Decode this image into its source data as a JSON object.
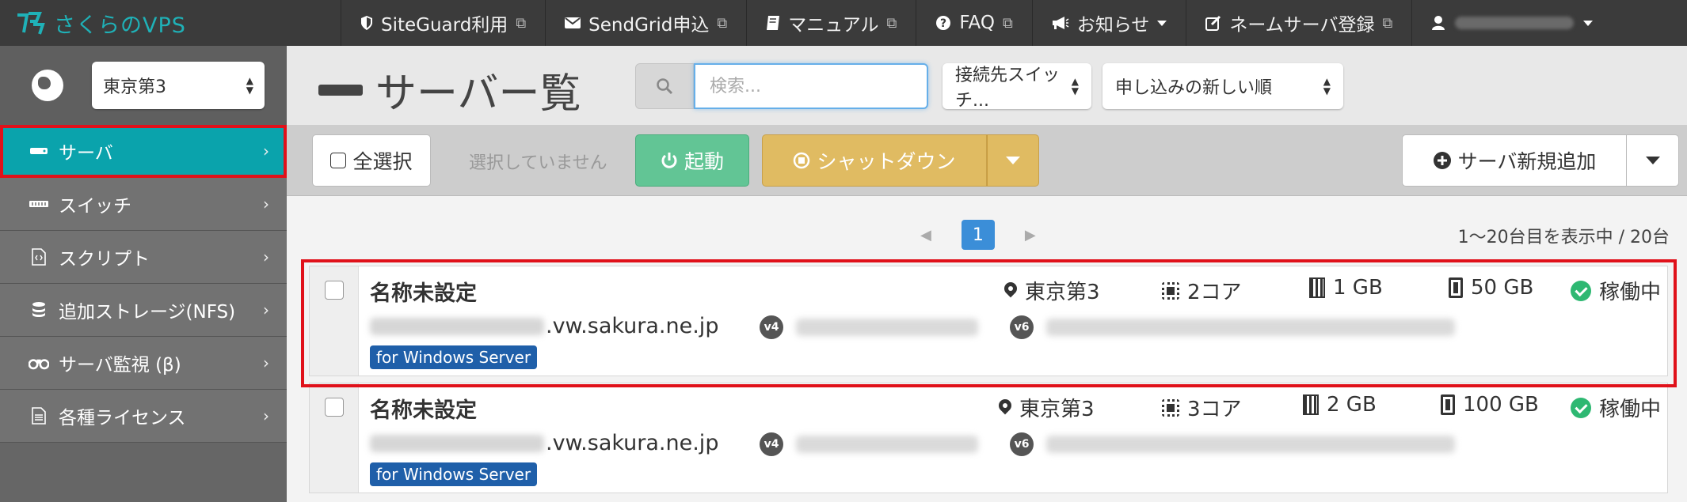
{
  "brand": {
    "logo_text": "さくらのVPS",
    "color": "#1fb1b7"
  },
  "topnav": {
    "items": [
      {
        "label": "SiteGuard利用",
        "icon": "shield-icon"
      },
      {
        "label": "SendGrid申込",
        "icon": "envelope-icon"
      },
      {
        "label": "マニュアル",
        "icon": "book-icon"
      },
      {
        "label": "FAQ",
        "icon": "question-icon"
      },
      {
        "label": "お知らせ",
        "icon": "megaphone-icon"
      },
      {
        "label": "ネームサーバ登録",
        "icon": "edit-icon"
      }
    ]
  },
  "sidebar": {
    "zone": "東京第3",
    "items": [
      {
        "label": "サーバ",
        "icon": "server-icon",
        "active": true
      },
      {
        "label": "スイッチ",
        "icon": "switch-icon"
      },
      {
        "label": "スクリプト",
        "icon": "script-icon"
      },
      {
        "label": "追加ストレージ(NFS)",
        "icon": "database-icon"
      },
      {
        "label": "サーバ監視 (β)",
        "icon": "binoculars-icon"
      },
      {
        "label": "各種ライセンス",
        "icon": "document-icon"
      }
    ]
  },
  "header": {
    "title": "サーバー覧",
    "search_placeholder": "検索...",
    "switch_filter": "接続先スイッチ...",
    "sort": "申し込みの新しい順"
  },
  "toolbar": {
    "select_all": "全選択",
    "selection_status": "選択していません",
    "start": "起動",
    "shutdown": "シャットダウン",
    "add_server": "サーバ新規追加"
  },
  "pagination": {
    "current": "1",
    "range_text": "1〜20台目を表示中 / 20台"
  },
  "servers": [
    {
      "name": "名称未設定",
      "zone": "東京第3",
      "cpu": "2コア",
      "memory": "1 GB",
      "disk": "50 GB",
      "status": "稼働中",
      "domain": ".vw.sakura.ne.jp",
      "v4": "v4",
      "v6": "v6",
      "tag": "for Windows Server"
    },
    {
      "name": "名称未設定",
      "zone": "東京第3",
      "cpu": "3コア",
      "memory": "2 GB",
      "disk": "100 GB",
      "status": "稼働中",
      "domain": ".vw.sakura.ne.jp",
      "v4": "v4",
      "v6": "v6",
      "tag": "for Windows Server"
    }
  ]
}
